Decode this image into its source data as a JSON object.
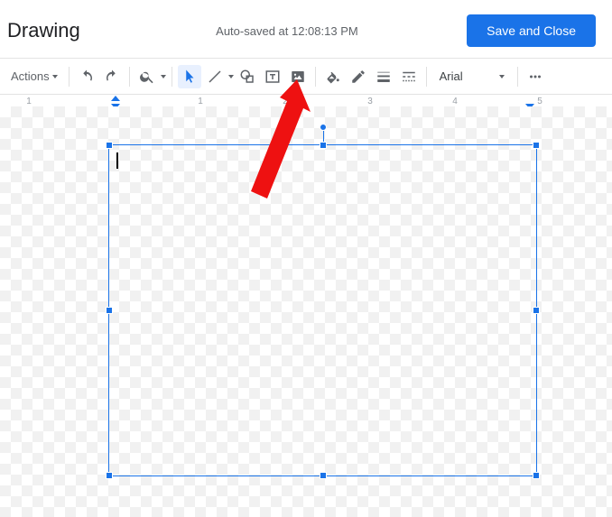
{
  "header": {
    "title": "Drawing",
    "autosave": "Auto-saved at 12:08:13 PM",
    "save_close": "Save and Close"
  },
  "toolbar": {
    "actions_label": "Actions",
    "font_name": "Arial"
  },
  "ruler": {
    "numbers": [
      "1",
      "1",
      "2",
      "3",
      "4",
      "5"
    ]
  }
}
